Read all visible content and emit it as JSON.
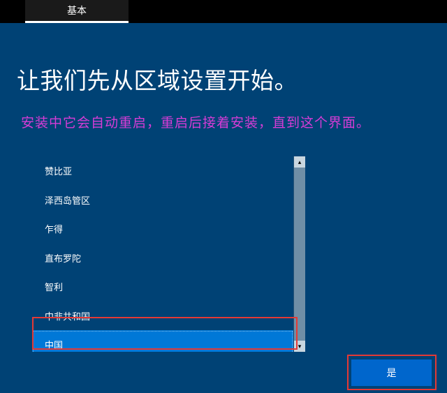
{
  "topbar": {
    "tab_label": "基本"
  },
  "heading": "让我们先从区域设置开始。",
  "annotation": "安装中它会自动重启，重启后接着安装，直到这个界面。",
  "regions": [
    {
      "label": "赞比亚",
      "selected": false
    },
    {
      "label": "泽西岛管区",
      "selected": false
    },
    {
      "label": "乍得",
      "selected": false
    },
    {
      "label": "直布罗陀",
      "selected": false
    },
    {
      "label": "智利",
      "selected": false
    },
    {
      "label": "中非共和国",
      "selected": false
    },
    {
      "label": "中国",
      "selected": true
    }
  ],
  "buttons": {
    "yes_label": "是"
  },
  "highlight_color": "#e53935",
  "colors": {
    "background": "#004275",
    "selected_bg": "#0078d7",
    "button_bg": "#0066cc",
    "annotation_text": "#d63cd6"
  }
}
